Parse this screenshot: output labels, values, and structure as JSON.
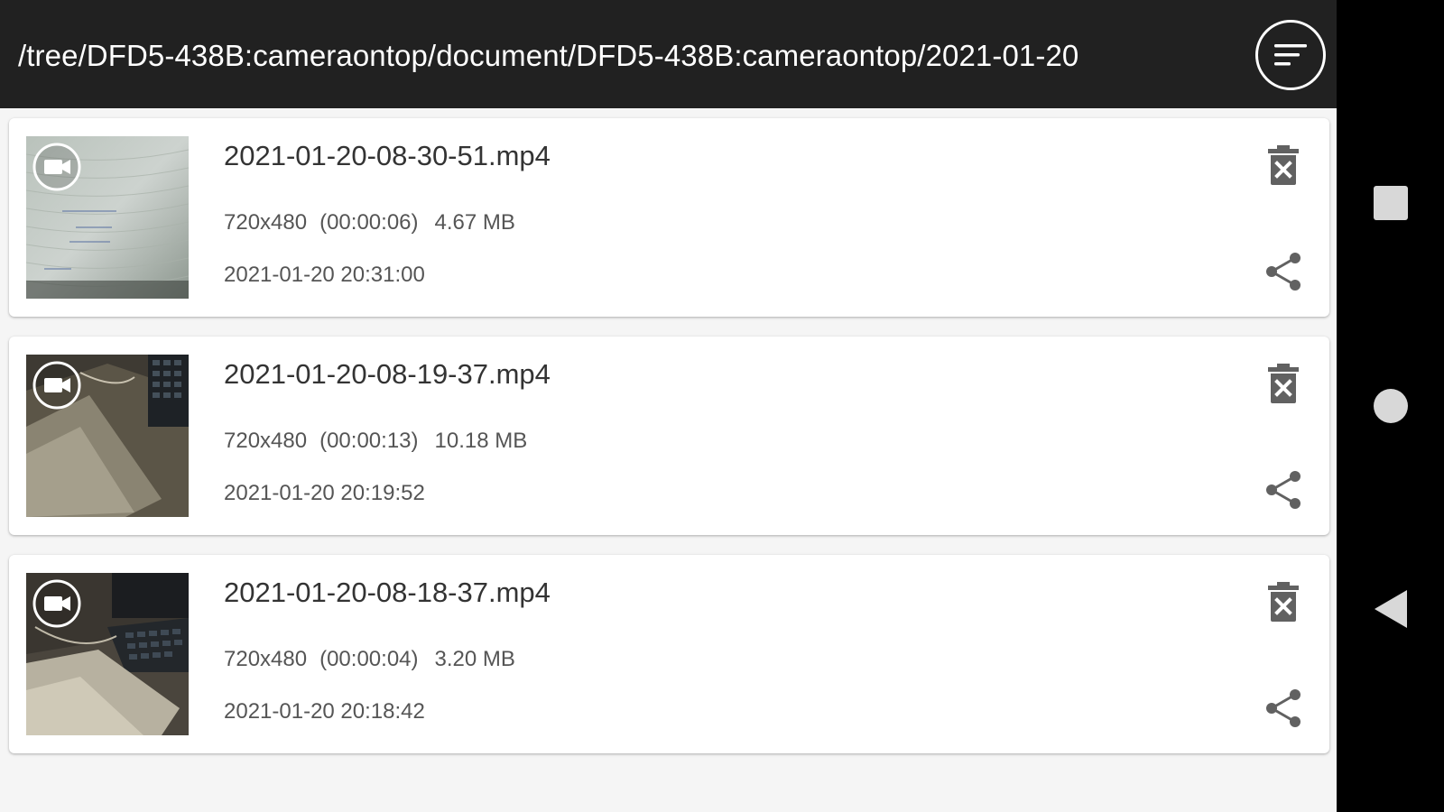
{
  "header": {
    "path": "/tree/DFD5-438B:cameraontop/document/DFD5-438B:cameraontop/2021-01-20",
    "sort_icon": "sort-lines-icon"
  },
  "files": [
    {
      "name": "2021-01-20-08-30-51.mp4",
      "resolution": "720x480",
      "duration": "(00:00:06)",
      "size": "4.67 MB",
      "modified": "2021-01-20 20:31:00",
      "thumb_icon": "video-camera-icon"
    },
    {
      "name": "2021-01-20-08-19-37.mp4",
      "resolution": "720x480",
      "duration": "(00:00:13)",
      "size": "10.18 MB",
      "modified": "2021-01-20 20:19:52",
      "thumb_icon": "video-camera-icon"
    },
    {
      "name": "2021-01-20-08-18-37.mp4",
      "resolution": "720x480",
      "duration": "(00:00:04)",
      "size": "3.20 MB",
      "modified": "2021-01-20 20:18:42",
      "thumb_icon": "video-camera-icon"
    }
  ],
  "item_actions": {
    "delete_icon": "delete-icon",
    "share_icon": "share-icon"
  },
  "navbar": {
    "buttons": [
      "recents-icon",
      "home-icon",
      "back-icon"
    ]
  },
  "colors": {
    "header_bg": "#212121",
    "list_bg": "#f5f5f5",
    "card_bg": "#ffffff",
    "icon_gray": "#616161",
    "nav_icon": "#d8d8d8"
  }
}
